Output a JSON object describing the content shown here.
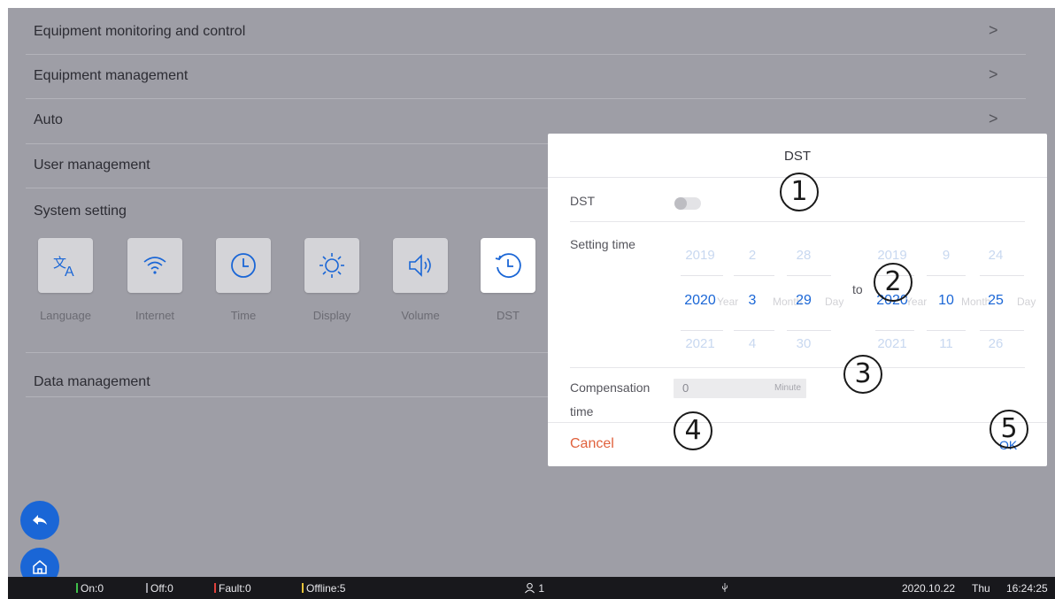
{
  "menu": {
    "monitoring": "Equipment monitoring and control",
    "management": "Equipment management",
    "auto": "Auto",
    "user": "User management",
    "system": "System setting",
    "data": "Data management",
    "chevron": ">"
  },
  "system_tiles": [
    {
      "label": "Language",
      "icon": "language-icon"
    },
    {
      "label": "Internet",
      "icon": "wifi-icon"
    },
    {
      "label": "Time",
      "icon": "clock-icon"
    },
    {
      "label": "Display",
      "icon": "brightness-icon"
    },
    {
      "label": "Volume",
      "icon": "volume-icon"
    },
    {
      "label": "DST",
      "icon": "dst-icon"
    }
  ],
  "dialog": {
    "title": "DST",
    "dst_label": "DST",
    "dst_enabled": false,
    "setting_time_label": "Setting time",
    "to_label": "to",
    "start": {
      "year": {
        "prev": "2019",
        "sel": "2020",
        "next": "2021",
        "unit": "Year"
      },
      "month": {
        "prev": "2",
        "sel": "3",
        "next": "4",
        "unit": "Month"
      },
      "day": {
        "prev": "28",
        "sel": "29",
        "next": "30",
        "unit": "Day"
      }
    },
    "end": {
      "year": {
        "prev": "2019",
        "sel": "2020",
        "next": "2021",
        "unit": "Year"
      },
      "month": {
        "prev": "9",
        "sel": "10",
        "next": "11",
        "unit": "Month"
      },
      "day": {
        "prev": "24",
        "sel": "25",
        "next": "26",
        "unit": "Day"
      }
    },
    "compensation_label_1": "Compensation",
    "compensation_label_2": "time",
    "compensation_value": "0",
    "compensation_unit": "Minute",
    "cancel": "Cancel",
    "ok": "OK"
  },
  "annotations": [
    "1",
    "2",
    "3",
    "4",
    "5"
  ],
  "status": {
    "on": "On:0",
    "off": "Off:0",
    "fault": "Fault:0",
    "offline": "Offline:5",
    "users": "1",
    "date": "2020.10.22",
    "weekday": "Thu",
    "time": "16:24:25"
  },
  "colors": {
    "accent": "#1a66d6",
    "cancel": "#e0613c",
    "on": "#3fbf4a",
    "off": "#9a9aa2",
    "fault": "#e0413c",
    "offline": "#e8c43a"
  }
}
